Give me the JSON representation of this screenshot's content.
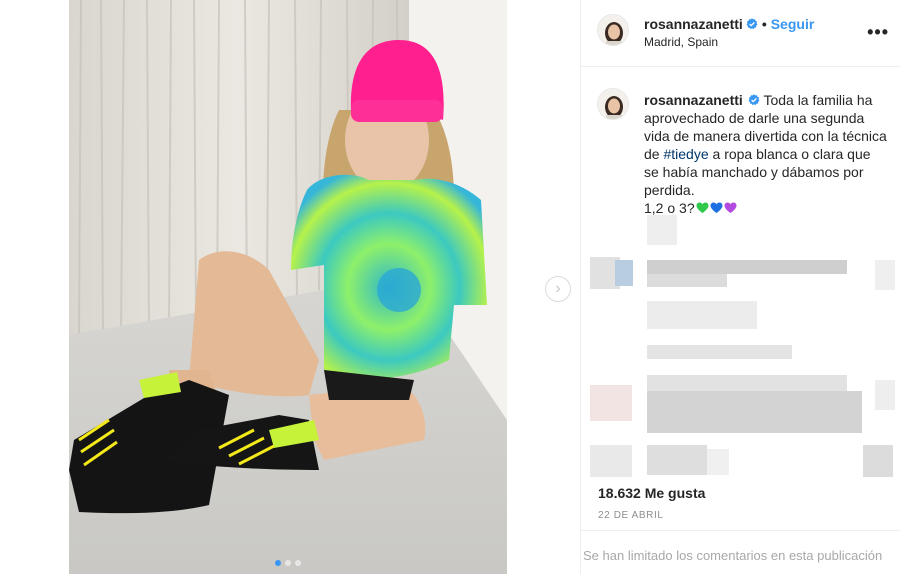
{
  "post": {
    "username": "rosannazanetti",
    "follow_label": "Seguir",
    "location": "Madrid, Spain",
    "more_icon": "•••",
    "caption_text_1": "Toda la familia ha aprovechado de darle una segunda vida de manera divertida con la técnica de ",
    "hashtag": "#tiedye",
    "caption_text_2": " a ropa blanca o clara que se había manchado y dábamos por perdida.",
    "caption_text_3": "1,2 o 3?",
    "likes": "18.632 Me gusta",
    "date": "22 DE ABRIL",
    "comments_limited": "Se han limitado los comentarios en esta publicación",
    "next_arrow": "›"
  },
  "colors": {
    "accent": "#3897f0",
    "hashtag": "#00376b",
    "text": "#262626",
    "muted": "#8e8e8e",
    "heart_green": "#2ec94a",
    "heart_blue": "#1e6fe0",
    "heart_purple": "#b44be0",
    "beanie": "#ff1f8e"
  },
  "icons": [
    "verified-badge-icon",
    "more-options-icon",
    "next-arrow-icon",
    "green-heart-icon",
    "blue-heart-icon",
    "purple-heart-icon"
  ]
}
